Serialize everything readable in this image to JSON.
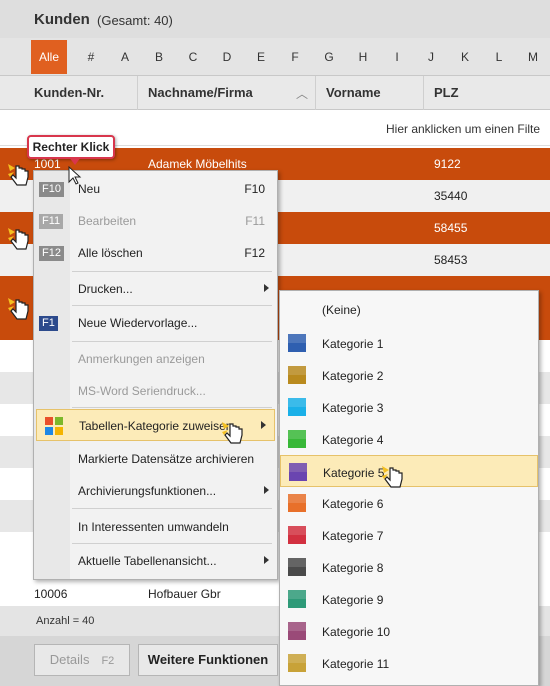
{
  "header": {
    "title": "Kunden",
    "count": "(Gesamt: 40)"
  },
  "alphabet": [
    "Alle",
    "#",
    "A",
    "B",
    "C",
    "D",
    "E",
    "F",
    "G",
    "H",
    "I",
    "J",
    "K",
    "L",
    "M"
  ],
  "columns": {
    "kundennr": "Kunden-Nr.",
    "nachname": "Nachname/Firma",
    "vorname": "Vorname",
    "plz": "PLZ"
  },
  "filter_hint": "Hier anklicken um einen Filte",
  "rows": {
    "r1": {
      "nr": "1001",
      "name": "Adamek Möbelhits",
      "plz": "9122"
    },
    "r2": {
      "plz": "35440"
    },
    "r3": {
      "plz": "58455"
    },
    "r4": {
      "plz": "58453"
    },
    "r_last": {
      "nr": "10006",
      "name": "Hofbauer Gbr"
    }
  },
  "footer": {
    "count": "Anzahl = 40",
    "details": "Details",
    "details_key": "F2",
    "more": "Weitere Funktionen"
  },
  "callout": "Rechter Klick",
  "context_menu": {
    "neu": {
      "badge": "F10",
      "label": "Neu",
      "shortcut": "F10"
    },
    "bearbeiten": {
      "badge": "F11",
      "label": "Bearbeiten",
      "shortcut": "F11"
    },
    "alle_loeschen": {
      "badge": "F12",
      "label": "Alle löschen",
      "shortcut": "F12"
    },
    "drucken": {
      "label": "Drucken..."
    },
    "wiedervorlage": {
      "badge": "F1",
      "label": "Neue Wiedervorlage..."
    },
    "anmerkungen": {
      "label": "Anmerkungen anzeigen"
    },
    "msword": {
      "label": "MS-Word Seriendruck..."
    },
    "kategorie": {
      "label": "Tabellen-Kategorie zuweisen"
    },
    "archivieren": {
      "label": "Markierte Datensätze archivieren"
    },
    "archivierung": {
      "label": "Archivierungsfunktionen..."
    },
    "interessenten": {
      "label": "In Interessenten umwandeln"
    },
    "ansicht": {
      "label": "Aktuelle Tabellenansicht..."
    }
  },
  "submenu": {
    "keine": "(Keine)",
    "k1": "Kategorie 1",
    "k2": "Kategorie 2",
    "k3": "Kategorie 3",
    "k4": "Kategorie 4",
    "k5": "Kategorie 5",
    "k6": "Kategorie 6",
    "k7": "Kategorie 7",
    "k8": "Kategorie 8",
    "k9": "Kategorie 9",
    "k10": "Kategorie 10",
    "k11": "Kategorie 11"
  },
  "colors": {
    "accent": "#e06020",
    "selected_row": "#c84b0c",
    "highlight": "#fcebb8",
    "k1": "#2f5fb0",
    "k2": "#b98a1e",
    "k3": "#1ab0e8",
    "k4": "#38b838",
    "k5": "#6a45b0",
    "k6": "#e8702a",
    "k7": "#d23040",
    "k8": "#4a4a4a",
    "k9": "#2e9a78",
    "k10": "#9a4a78",
    "k11": "#c8a238"
  }
}
